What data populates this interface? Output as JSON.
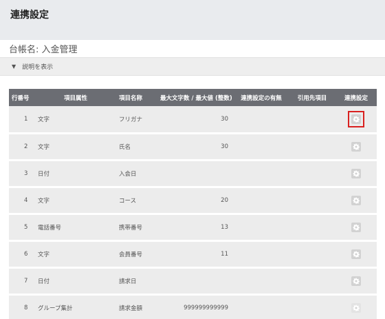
{
  "page": {
    "title": "連携設定"
  },
  "ledger": {
    "label": "台帳名",
    "separator": ": ",
    "name": "入金管理"
  },
  "description_toggle": {
    "label": "説明を表示"
  },
  "table": {
    "headers": {
      "row_no": "行番号",
      "attribute": "項目属性",
      "item_name": "項目名称",
      "max": "最大文字数 / 最大値 (整数)",
      "has_link": "連携設定の有無",
      "ref_item": "引用先項目",
      "link_setting": "連携設定"
    },
    "rows": [
      {
        "no": "1",
        "attribute": "文字",
        "name": "フリガナ",
        "max": "30",
        "has_link": "",
        "ref": "",
        "gear_state": "selected"
      },
      {
        "no": "2",
        "attribute": "文字",
        "name": "氏名",
        "max": "30",
        "has_link": "",
        "ref": "",
        "gear_state": "normal"
      },
      {
        "no": "3",
        "attribute": "日付",
        "name": "入会日",
        "max": "",
        "has_link": "",
        "ref": "",
        "gear_state": "normal"
      },
      {
        "no": "4",
        "attribute": "文字",
        "name": "コース",
        "max": "20",
        "has_link": "",
        "ref": "",
        "gear_state": "normal"
      },
      {
        "no": "5",
        "attribute": "電話番号",
        "name": "携帯番号",
        "max": "13",
        "has_link": "",
        "ref": "",
        "gear_state": "normal"
      },
      {
        "no": "6",
        "attribute": "文字",
        "name": "会員番号",
        "max": "11",
        "has_link": "",
        "ref": "",
        "gear_state": "normal"
      },
      {
        "no": "7",
        "attribute": "日付",
        "name": "請求日",
        "max": "",
        "has_link": "",
        "ref": "",
        "gear_state": "normal"
      },
      {
        "no": "8",
        "attribute": "グループ集計",
        "name": "請求金額",
        "max": "999999999999",
        "has_link": "",
        "ref": "",
        "gear_state": "faded"
      }
    ]
  },
  "icons": {
    "gear": "gear-icon",
    "caret": "caret-down-icon"
  },
  "colors": {
    "header_bg": "#6b6d73",
    "row_bg": "#ececec",
    "highlight": "#d9201f"
  }
}
